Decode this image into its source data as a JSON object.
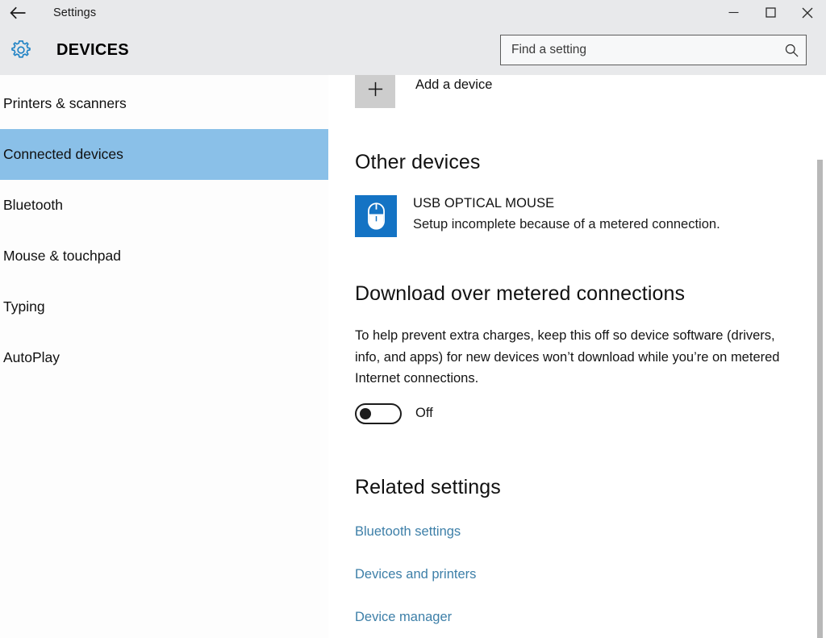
{
  "window": {
    "title": "Settings",
    "back_icon": "back-arrow-icon",
    "minimize_label": "─",
    "maximize_label": "□",
    "close_label": "✕"
  },
  "header": {
    "icon": "gear-icon",
    "title": "DEVICES",
    "search": {
      "placeholder": "Find a setting",
      "value": "",
      "icon": "search-icon"
    }
  },
  "sidebar": {
    "items": [
      {
        "label": "Printers & scanners",
        "selected": false
      },
      {
        "label": "Connected devices",
        "selected": true
      },
      {
        "label": "Bluetooth",
        "selected": false
      },
      {
        "label": "Mouse & touchpad",
        "selected": false
      },
      {
        "label": "Typing",
        "selected": false
      },
      {
        "label": "AutoPlay",
        "selected": false
      }
    ],
    "selected_background": "#8ac0e8"
  },
  "main": {
    "add_device": {
      "icon": "plus-icon",
      "label": "Add a device"
    },
    "other_devices": {
      "heading": "Other devices",
      "devices": [
        {
          "icon": "mouse-icon",
          "icon_background": "#1473c4",
          "name": "USB OPTICAL MOUSE",
          "status": "Setup incomplete because of a metered connection."
        }
      ]
    },
    "metered": {
      "heading": "Download over metered connections",
      "description": "To help prevent extra charges, keep this off so device software (drivers, info, and apps) for new devices won’t download while you’re on metered Internet connections.",
      "toggle": {
        "state_label": "Off",
        "checked": false
      }
    },
    "related_settings": {
      "heading": "Related settings",
      "links": [
        {
          "label": "Bluetooth settings"
        },
        {
          "label": "Devices and printers"
        },
        {
          "label": "Device manager"
        }
      ],
      "link_color": "#3d7fa8"
    }
  },
  "scrollbar": {
    "name": "vertical-scrollbar"
  }
}
